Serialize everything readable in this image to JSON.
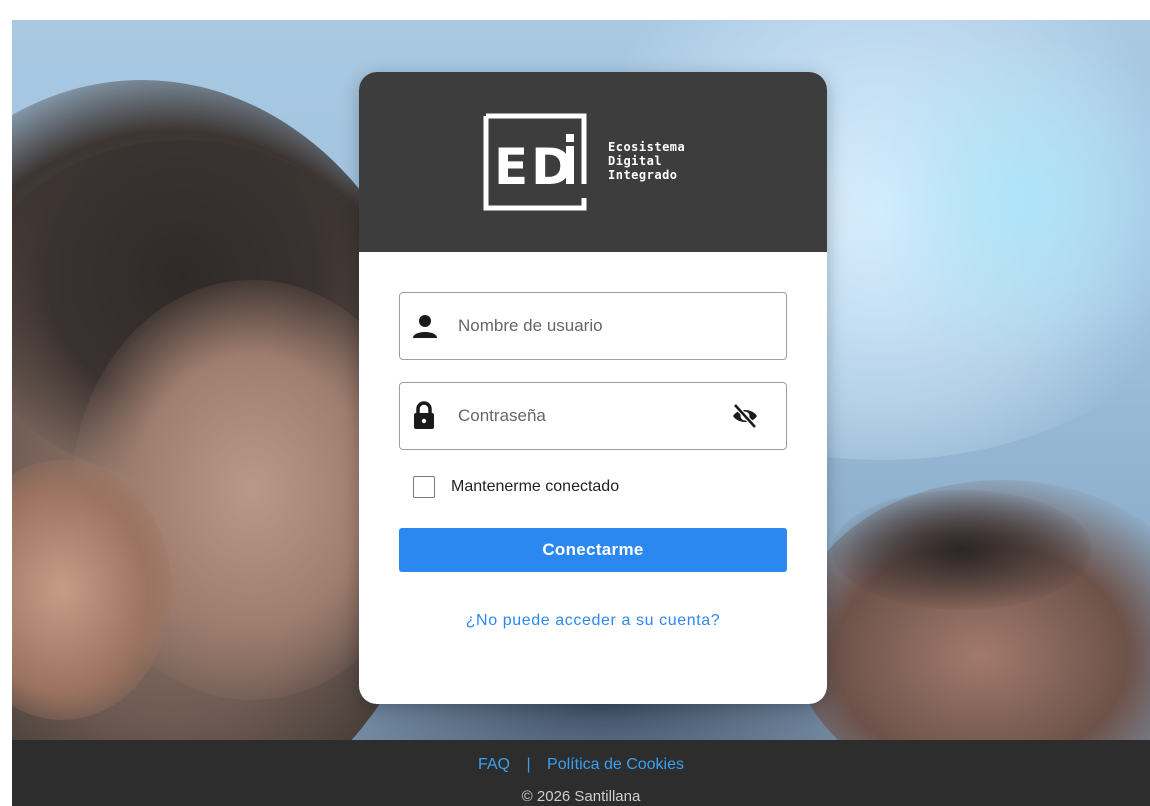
{
  "brand": {
    "logo_letters": "EDi",
    "name_line1": "Ecosistema",
    "name_line2": "Digital",
    "name_line3": "Integrado"
  },
  "form": {
    "username_placeholder": "Nombre de usuario",
    "username_value": "",
    "password_placeholder": "Contraseña",
    "password_value": "",
    "remember_label": "Mantenerme conectado",
    "remember_checked": false,
    "submit_label": "Conectarme",
    "forgot_link": "¿No puede acceder a su cuenta?"
  },
  "footer": {
    "faq_link": "FAQ",
    "separator": "|",
    "cookies_link": "Política de Cookies",
    "copyright": "© 2026 Santillana"
  },
  "icons": {
    "username": "user-icon",
    "password": "lock-icon",
    "toggle_password": "eye-slash-icon"
  },
  "colors": {
    "primary": "#2b88f0",
    "header_bg": "#3d3d3d",
    "footer_bg": "#2d2d2d"
  }
}
